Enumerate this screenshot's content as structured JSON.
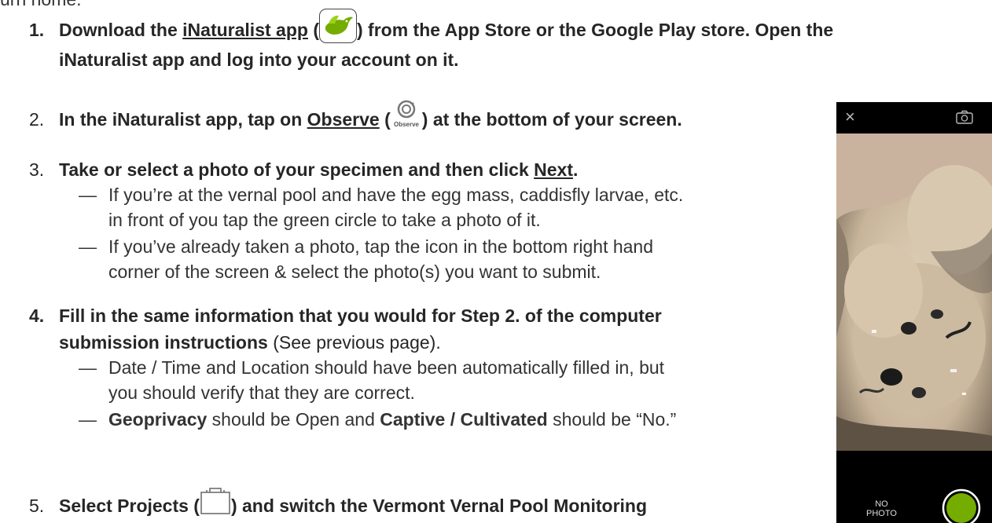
{
  "fragment": "urn home.",
  "steps": [
    {
      "num": "1.",
      "l1a": "Download the ",
      "l1b": "iNaturalist app",
      "l1c": " (",
      "l1d": ") from the App Store or the Google Play store. Open the",
      "l2": "iNaturalist app and log into your account on it."
    },
    {
      "num": "2.",
      "a": "In the iNaturalist app, tap on ",
      "b": "Observe",
      "c": " (",
      "d": ") at the bottom of your screen.",
      "icon_label": "Observe"
    },
    {
      "num": "3.",
      "a": "Take or select a photo of your specimen and then click ",
      "b": "Next",
      "c": ".",
      "subs": [
        {
          "l1": "If you’re at the vernal pool and have the egg mass, caddisfly larvae, etc.",
          "l2": "in front of you tap the green circle to take a photo of it."
        },
        {
          "l1": "If you’ve already taken a photo, tap the icon in the bottom right hand",
          "l2": "corner of the screen & select the photo(s) you want to submit."
        }
      ]
    },
    {
      "num": "4.",
      "l1": "Fill in the same information that you would for Step 2. of the computer",
      "l2a": "submission instructions",
      "l2b": " (See previous page).",
      "sub1": {
        "l1": "Date / Time and Location should have been automatically filled in, but",
        "l2": "you should verify that they are correct."
      },
      "sub2": {
        "a": "Geoprivacy",
        "b": " should be Open and ",
        "c": "Captive / Cultivated",
        "d": " should be “No.”"
      }
    },
    {
      "num": "5.",
      "a": "Select Projects (",
      "b": ") and switch the Vermont Vernal Pool Monitoring"
    }
  ],
  "phone": {
    "close": "×",
    "no_photo_1": "NO",
    "no_photo_2": "PHOTO",
    "shutter_color": "#74ac00",
    "brand_green": "#74ac00"
  }
}
